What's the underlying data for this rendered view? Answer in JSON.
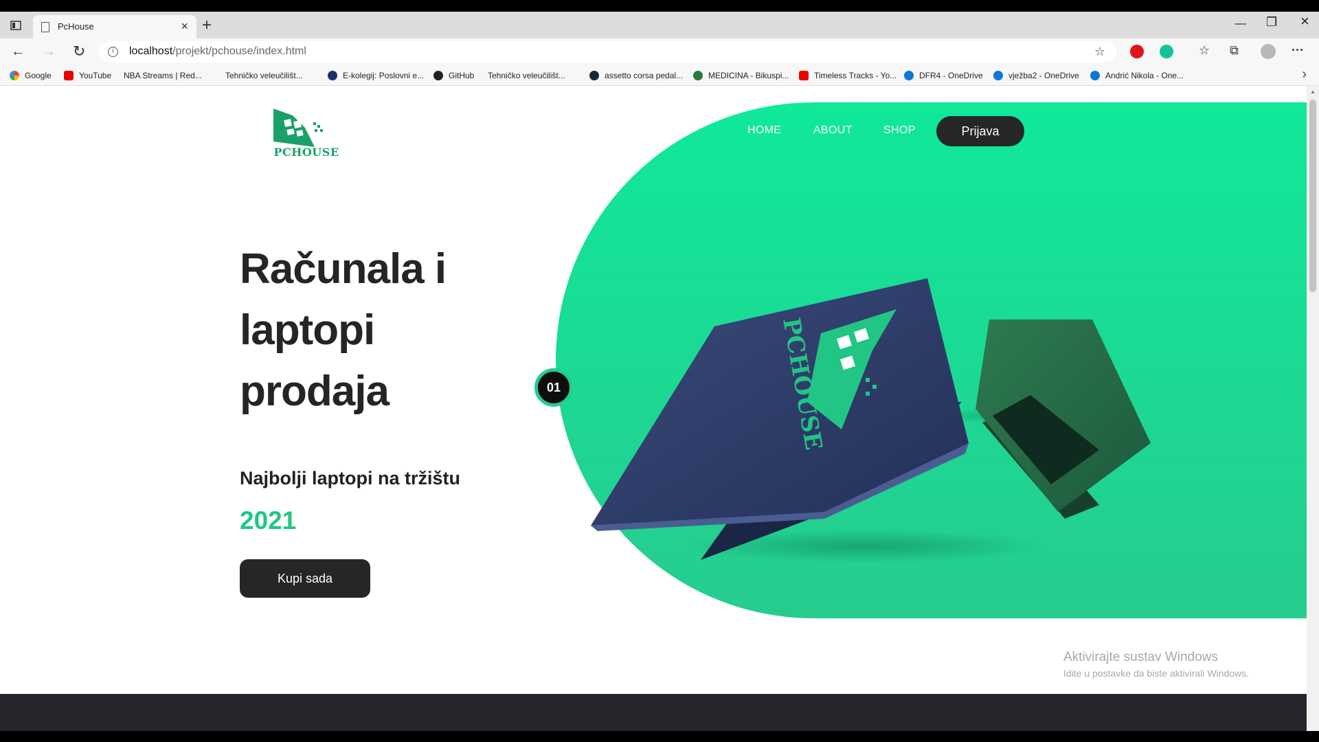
{
  "browser": {
    "tab_title": "PcHouse",
    "url_host": "localhost",
    "url_path": "/projekt/pchouse/index.html",
    "bookmarks": [
      {
        "label": "Google",
        "icon": "google-icon"
      },
      {
        "label": "YouTube",
        "icon": "youtube-icon"
      },
      {
        "label": "NBA Streams | Red...",
        "icon": "page-icon"
      },
      {
        "label": "Tehničko veleučilišt...",
        "icon": "page-icon"
      },
      {
        "label": "E-kolegij: Poslovni e...",
        "icon": "ekolegij-icon"
      },
      {
        "label": "GitHub",
        "icon": "github-icon"
      },
      {
        "label": "Tehničko veleučilišt...",
        "icon": "page-icon"
      },
      {
        "label": "assetto corsa pedal...",
        "icon": "steam-icon"
      },
      {
        "label": "MEDICINA - Bikuspi...",
        "icon": "globe-icon"
      },
      {
        "label": "Timeless Tracks - Yo...",
        "icon": "youtube-icon"
      },
      {
        "label": "DFR4 - OneDrive",
        "icon": "onedrive-icon"
      },
      {
        "label": "vježba2 - OneDrive",
        "icon": "onedrive-icon"
      },
      {
        "label": "Andrić Nikola - One...",
        "icon": "onedrive-icon"
      }
    ]
  },
  "site": {
    "logo_text": "PCHOUSE",
    "nav": [
      "HOME",
      "ABOUT",
      "SHOP"
    ],
    "login_label": "Prijava",
    "hero_title": "Računala i laptopi prodaja",
    "hero_subtitle": "Najbolji laptopi na tržištu",
    "hero_year": "2021",
    "buy_label": "Kupi sada",
    "slide_number": "01",
    "laptop_brand": "PCHOUSE"
  },
  "watermark": {
    "line1": "Aktivirajte sustav Windows",
    "line2": "Idite u postavke da biste aktivirali Windows."
  },
  "colors": {
    "accent": "#10e89a",
    "accent_dark": "#21c684",
    "dark": "#252626"
  }
}
